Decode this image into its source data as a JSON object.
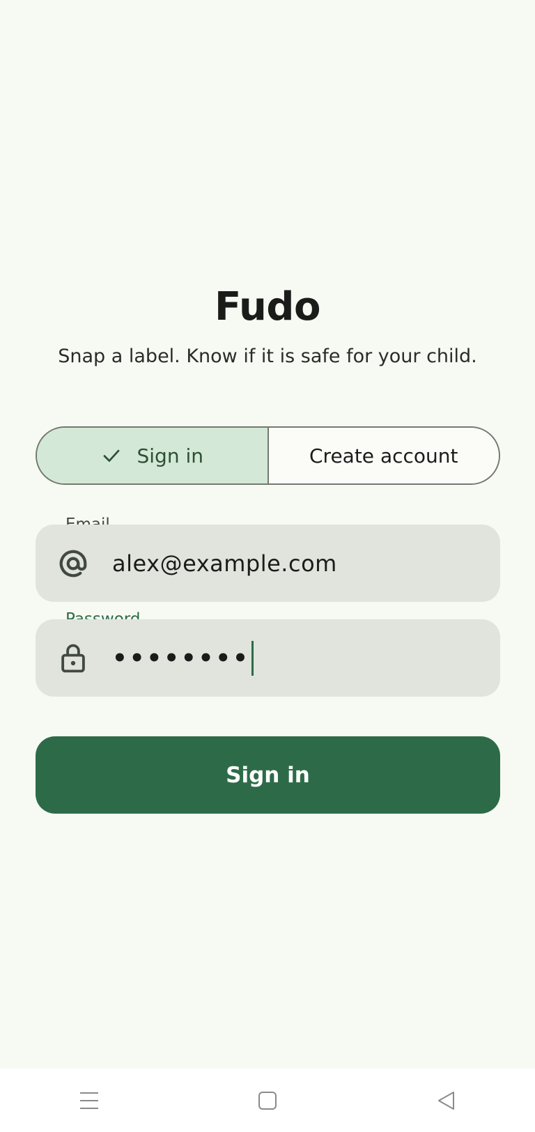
{
  "app": {
    "title": "Fudo",
    "subtitle": "Snap a label. Know if it is safe for your child."
  },
  "tabs": [
    {
      "label": "Sign in",
      "selected": true
    },
    {
      "label": "Create account",
      "selected": false
    }
  ],
  "form": {
    "email": {
      "label": "Email",
      "value": "alex@example.com",
      "icon": "at-icon"
    },
    "password": {
      "label": "Password",
      "value": "••••••••",
      "icon": "lock-icon",
      "focused": true
    }
  },
  "submit": {
    "label": "Sign in"
  },
  "nav": {
    "icons": [
      "menu-icon",
      "home-icon",
      "back-icon"
    ]
  },
  "colors": {
    "background": "#f7faf3",
    "primary": "#2d6b48",
    "tab_selected": "#d3e8d6",
    "field_bg": "#e1e4dd"
  }
}
